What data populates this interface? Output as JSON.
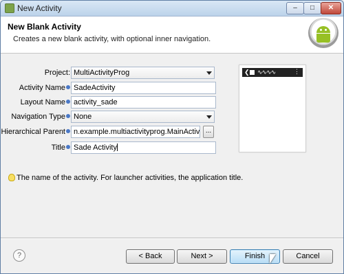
{
  "window": {
    "title": "New Activity",
    "controls": {
      "minimize": "–",
      "maximize": "□",
      "close": "✕"
    }
  },
  "header": {
    "title": "New Blank Activity",
    "description": "Creates a new blank activity, with optional inner navigation."
  },
  "form": {
    "project": {
      "label": "Project:",
      "value": "MultiActivityProg"
    },
    "activity_name": {
      "label": "Activity Name",
      "value": "SadeActivity"
    },
    "layout_name": {
      "label": "Layout Name",
      "value": "activity_sade"
    },
    "navigation_type": {
      "label": "Navigation Type",
      "value": "None"
    },
    "hierarchical_parent": {
      "label": "Hierarchical Parent",
      "value": "n.example.multiactivityprog.MainActivity",
      "browse_label": "..."
    },
    "title": {
      "label": "Title",
      "value": "Sade Activity"
    }
  },
  "hint": {
    "text": "The name of the activity. For launcher activities, the application title."
  },
  "buttons": {
    "help": "?",
    "back": "< Back",
    "next": "Next >",
    "finish": "Finish",
    "cancel": "Cancel"
  },
  "colors": {
    "finish_accent": "#3c7fb1",
    "android_green": "#97c024"
  }
}
